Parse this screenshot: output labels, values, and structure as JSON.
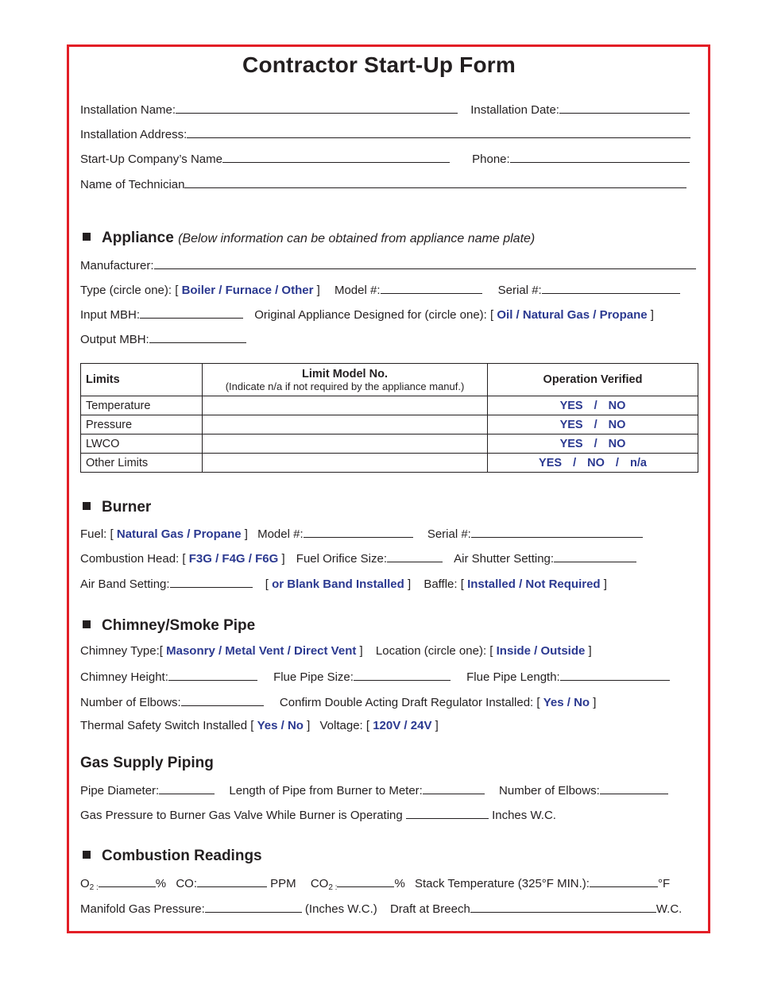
{
  "title": "Contractor Start-Up Form",
  "header_fields": {
    "installation_name": "Installation Name:",
    "installation_date": "Installation Date:",
    "installation_address": "Installation  Address:",
    "company_name": "Start-Up  Company’s  Name",
    "phone": "Phone:",
    "technician": "Name  of  Technician"
  },
  "appliance": {
    "heading": "Appliance",
    "note": "(Below information can be obtained from appliance name plate)",
    "manufacturer": "Manufacturer:",
    "type_label": "Type (circle one): [",
    "type_options": "Boiler / Furnace / Other",
    "model": "Model #:",
    "serial": "Serial #:",
    "input_mbh": "Input MBH:",
    "designed_label": "Original Appliance Designed for (circle one): [",
    "designed_options": "Oil / Natural Gas / Propane",
    "output_mbh": "Output MBH:",
    "close": "]"
  },
  "limits_table": {
    "headers": [
      "Limits",
      "Limit Model No.",
      "(Indicate n/a if not required by the appliance manuf.)",
      "Operation Verified"
    ],
    "rows": [
      {
        "limit": "Temperature",
        "model": "",
        "verified": "YES / NO"
      },
      {
        "limit": "Pressure",
        "model": "",
        "verified": "YES / NO"
      },
      {
        "limit": "LWCO",
        "model": "",
        "verified": "YES / NO"
      },
      {
        "limit": "Other Limits",
        "model": "",
        "verified": "YES / NO / n/a"
      }
    ]
  },
  "burner": {
    "heading": "Burner",
    "fuel_label": "Fuel: [",
    "fuel_options": "Natural Gas / Propane",
    "model": "Model #:",
    "serial": "Serial #:",
    "head_label": "Combustion Head: [",
    "head_options": "F3G / F4G / F6G",
    "orifice": "Fuel Orifice Size:",
    "shutter": "Air Shutter Setting:",
    "air_band": "Air Band Setting:",
    "blank_band": "or Blank Band Installed",
    "baffle_label": "Baffle: [",
    "baffle_options": "Installed / Not Required",
    "open": "[",
    "close": "]"
  },
  "chimney": {
    "heading": "Chimney/Smoke Pipe",
    "type_label": "Chimney Type:[",
    "type_options": "Masonry / Metal Vent / Direct Vent",
    "location_label": "Location (circle one): [",
    "location_options": "Inside / Outside",
    "height": "Chimney Height:",
    "flue_size": "Flue Pipe Size:",
    "flue_length": "Flue Pipe Length:",
    "elbows": "Number of Elbows:",
    "regulator_label": "Confirm Double Acting Draft Regulator Installed: [",
    "yes_no": "Yes / No",
    "thermal_label": "Thermal Safety Switch Installed [",
    "voltage_label": "Voltage: [",
    "voltage_options": "120V / 24V",
    "close": "]"
  },
  "gas": {
    "heading": "Gas Supply Piping",
    "diameter": "Pipe Diameter:",
    "length": "Length of Pipe from Burner to Meter:",
    "elbows": "Number of Elbows:",
    "pressure": "Gas Pressure to Burner Gas Valve While Burner is Operating",
    "unit": "Inches W.C."
  },
  "combustion": {
    "heading": "Combustion Readings",
    "o2": "O",
    "sub2": "2 :",
    "pct": "%",
    "co": "CO:",
    "ppm": "PPM",
    "co2": "CO",
    "stack": "Stack Temperature (325°F MIN.):",
    "degf": "°F",
    "manifold": "Manifold Gas Pressure:",
    "manifold_unit": "(Inches W.C.)",
    "draft": "Draft at Breech",
    "wc": "W.C."
  }
}
